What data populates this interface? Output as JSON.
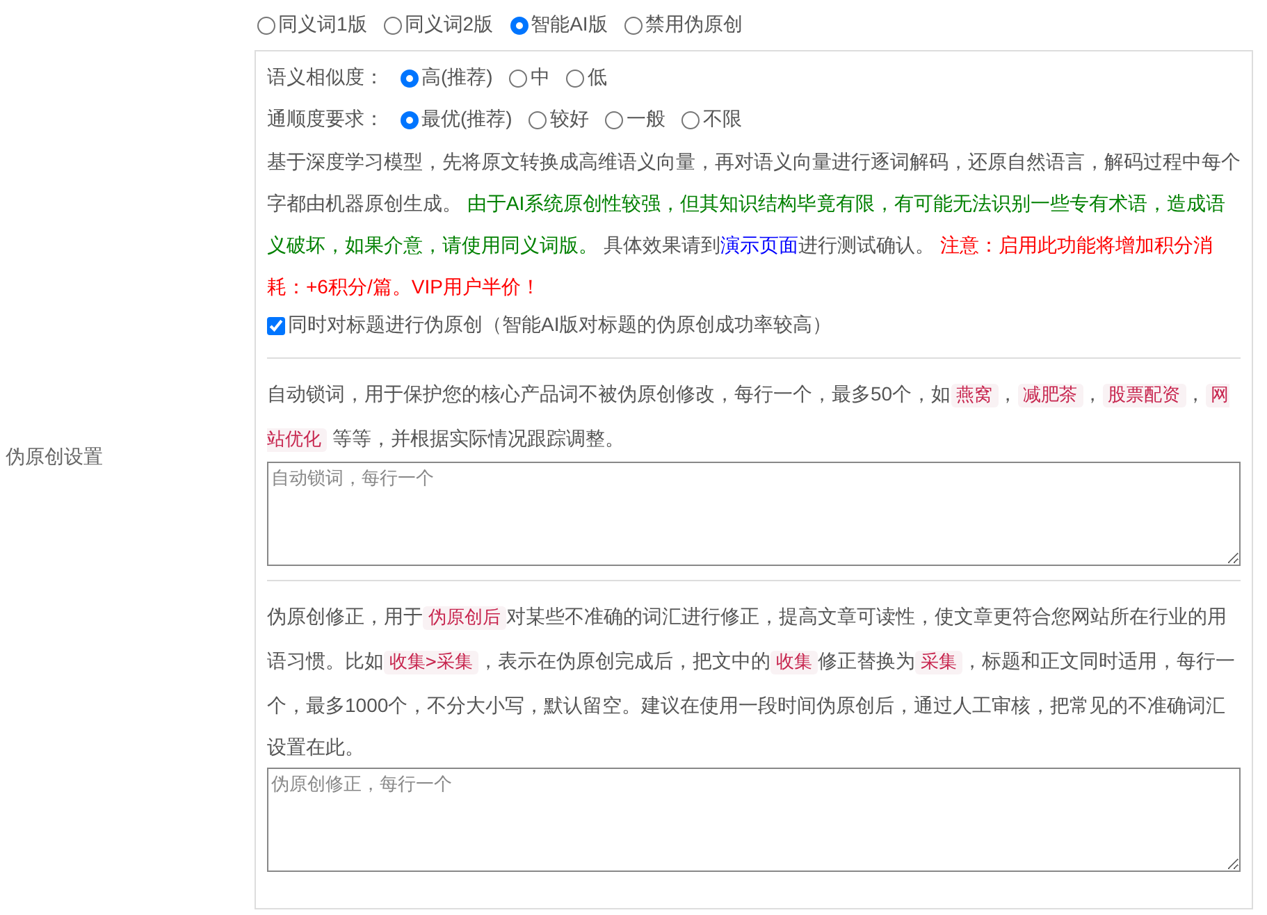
{
  "section_label": "伪原创设置",
  "mode_options": [
    {
      "label": "同义词1版",
      "selected": false
    },
    {
      "label": "同义词2版",
      "selected": false
    },
    {
      "label": "智能AI版",
      "selected": true
    },
    {
      "label": "禁用伪原创",
      "selected": false
    }
  ],
  "similarity": {
    "label": "语义相似度：",
    "options": [
      {
        "label": "高(推荐)",
        "selected": true
      },
      {
        "label": "中",
        "selected": false
      },
      {
        "label": "低",
        "selected": false
      }
    ]
  },
  "fluency": {
    "label": "通顺度要求：",
    "options": [
      {
        "label": "最优(推荐)",
        "selected": true
      },
      {
        "label": "较好",
        "selected": false
      },
      {
        "label": "一般",
        "selected": false
      },
      {
        "label": "不限",
        "selected": false
      }
    ]
  },
  "description": [
    {
      "kind": "plain",
      "text": "基于深度学习模型，先将原文转换成高维语义向量，再对语义向量进行逐词解码，还原自然语言，解码过程中每个字都由机器原创生成。 "
    },
    {
      "kind": "green",
      "text": "由于AI系统原创性较强，但其知识结构毕竟有限，有可能无法识别一些专有术语，造成语义破坏，如果介意，请使用同义词版。"
    },
    {
      "kind": "plain",
      "text": " 具体效果请到"
    },
    {
      "kind": "link",
      "text": "演示页面"
    },
    {
      "kind": "plain",
      "text": "进行测试确认。 "
    },
    {
      "kind": "red",
      "text": "注意：启用此功能将增加积分消耗：+6积分/篇。VIP用户半价！"
    }
  ],
  "title_option": {
    "label": "同时对标题进行伪原创（智能AI版对标题的伪原创成功率较高）",
    "checked": true
  },
  "lock_words": {
    "description": [
      {
        "kind": "plain",
        "text": "自动锁词，用于保护您的核心产品词不被伪原创修改，每行一个，最多50个，如"
      },
      {
        "kind": "code",
        "text": "燕窝"
      },
      {
        "kind": "plain",
        "text": "，"
      },
      {
        "kind": "code",
        "text": "减肥茶"
      },
      {
        "kind": "plain",
        "text": "，"
      },
      {
        "kind": "code",
        "text": "股票配资"
      },
      {
        "kind": "plain",
        "text": "，"
      },
      {
        "kind": "code",
        "text": "网站优化"
      },
      {
        "kind": "plain",
        "text": " 等等，并根据实际情况跟踪调整。"
      }
    ],
    "placeholder": "自动锁词，每行一个"
  },
  "correction": {
    "description": [
      {
        "kind": "plain",
        "text": "伪原创修正，用于"
      },
      {
        "kind": "code",
        "text": "伪原创后"
      },
      {
        "kind": "plain",
        "text": "对某些不准确的词汇进行修正，提高文章可读性，使文章更符合您网站所在行业的用语习惯。比如"
      },
      {
        "kind": "code",
        "text": "收集>采集"
      },
      {
        "kind": "plain",
        "text": "，表示在伪原创完成后，把文中的"
      },
      {
        "kind": "code",
        "text": "收集"
      },
      {
        "kind": "plain",
        "text": "修正替换为"
      },
      {
        "kind": "code",
        "text": "采集"
      },
      {
        "kind": "plain",
        "text": "，标题和正文同时适用，每行一个，最多1000个，不分大小写，默认留空。建议在使用一段时间伪原创后，通过人工审核，把常见的不准确词汇设置在此。"
      }
    ],
    "placeholder": "伪原创修正，每行一个"
  }
}
